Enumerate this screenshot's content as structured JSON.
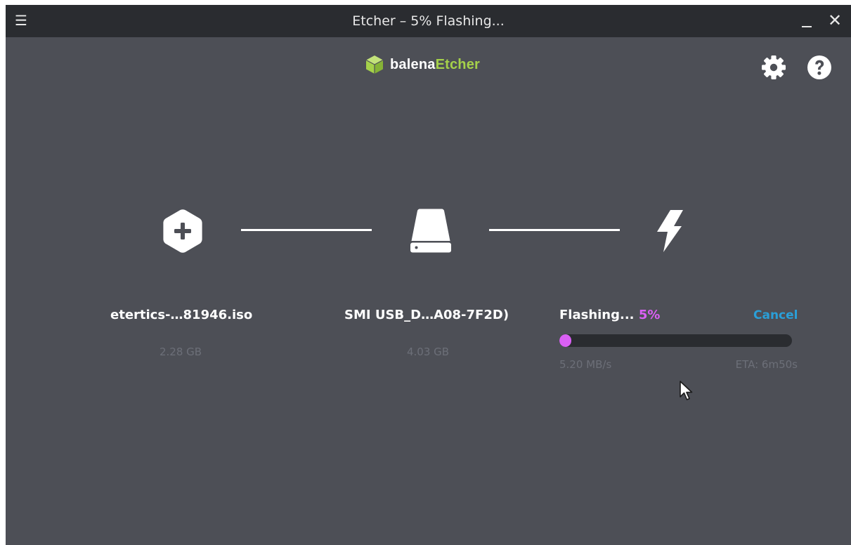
{
  "window": {
    "title": "Etcher – 5% Flashing...",
    "menu_icon": "hamburger-menu-icon",
    "minimize_icon": "minimize-icon",
    "close_icon": "close-icon"
  },
  "header": {
    "logo_icon": "balena-cube-icon",
    "logo_balena": "balena",
    "logo_etcher": "Etcher",
    "settings_icon": "gear-icon",
    "help_icon": "question-circle-icon"
  },
  "steps": {
    "image": {
      "icon": "hexagon-plus-icon",
      "name": "etertics-…81946.iso",
      "size": "2.28 GB"
    },
    "drive": {
      "icon": "hard-drive-icon",
      "name": "SMI USB_D…A08-7F2D)",
      "size": "4.03 GB"
    },
    "flash": {
      "icon": "lightning-bolt-icon",
      "status": "Flashing...",
      "percent_text": "5%",
      "cancel_label": "Cancel",
      "progress": 0.05,
      "speed": "5.20 MB/s",
      "eta": "ETA: 6m50s"
    }
  },
  "colors": {
    "background": "#4d4f56",
    "titlebar": "#2a2c30",
    "accent_green": "#a5d14a",
    "progress_purple": "#da60f4",
    "cancel_blue": "#2a9fd8",
    "muted_text": "#6c6f78"
  }
}
